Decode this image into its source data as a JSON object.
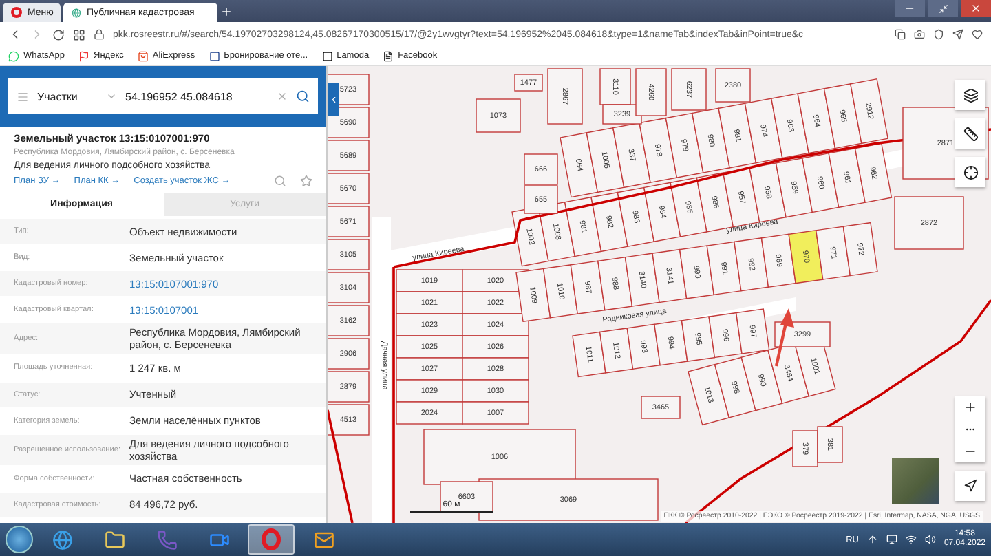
{
  "browser": {
    "tabs": [
      {
        "label": "Меню",
        "kind": "menu",
        "selected": false
      },
      {
        "label": "Публичная кадастровая",
        "kind": "page",
        "selected": true
      }
    ],
    "address": "pkk.rosreestr.ru/#/search/54.19702703298124,45.08267170300515/17/@2y1wvgtyr?text=54.196952%2045.084618&type=1&nameTab&indexTab&inPoint=true&c",
    "bookmarks": [
      {
        "label": "WhatsApp",
        "kind": "whatsapp"
      },
      {
        "label": "Яндекс",
        "kind": "yandex"
      },
      {
        "label": "AliExpress",
        "kind": "ali"
      },
      {
        "label": "Бронирование оте...",
        "kind": "booking"
      },
      {
        "label": "Lamoda",
        "kind": "lamoda"
      },
      {
        "label": "Facebook",
        "kind": "doc"
      }
    ]
  },
  "search": {
    "category": "Участки",
    "query": "54.196952 45.084618"
  },
  "card": {
    "title": "Земельный участок 13:15:0107001:970",
    "address": "Республика Мордовия, Лямбирский район, с. Берсеневка",
    "purpose": "Для ведения личного подсобного хозяйства",
    "links": [
      "План ЗУ →",
      "План КК →",
      "Создать участок ЖС →"
    ]
  },
  "tabs": [
    {
      "label": "Информация",
      "selected": true
    },
    {
      "label": "Услуги",
      "selected": false
    }
  ],
  "rows": [
    {
      "label": "Тип:",
      "value": "Объект недвижимости",
      "kind": "text"
    },
    {
      "label": "Вид:",
      "value": "Земельный участок",
      "kind": "text"
    },
    {
      "label": "Кадастровый номер:",
      "value": "13:15:0107001:970",
      "kind": "link"
    },
    {
      "label": "Кадастровый квартал:",
      "value": "13:15:0107001",
      "kind": "link"
    },
    {
      "label": "Адрес:",
      "value": "Республика Мордовия, Лямбирский район, с. Берсеневка",
      "kind": "text"
    },
    {
      "label": "Площадь уточненная:",
      "value": "1 247 кв. м",
      "kind": "text"
    },
    {
      "label": "Статус:",
      "value": "Учтенный",
      "kind": "text"
    },
    {
      "label": "Категория земель:",
      "value": "Земли населённых пунктов",
      "kind": "text"
    },
    {
      "label": "Разрешенное использование:",
      "value": "Для ведения личного подсобного хозяйства",
      "kind": "text"
    },
    {
      "label": "Форма собственности:",
      "value": "Частная собственность",
      "kind": "text"
    },
    {
      "label": "Кадастровая стоимость:",
      "value": "84 496,72 руб.",
      "kind": "text"
    }
  ],
  "map": {
    "rows": [
      {
        "parcels": [
          {
            "number": "664",
            "selected": false
          },
          {
            "number": "1005",
            "selected": false
          },
          {
            "number": "337",
            "selected": false
          },
          {
            "number": "978",
            "selected": false
          },
          {
            "number": "979",
            "selected": false
          },
          {
            "number": "980",
            "selected": false
          },
          {
            "number": "981",
            "selected": false
          },
          {
            "number": "974",
            "selected": false
          },
          {
            "number": "963",
            "selected": false
          },
          {
            "number": "964",
            "selected": false
          },
          {
            "number": "965",
            "selected": false
          },
          {
            "number": "2912",
            "selected": false
          }
        ]
      },
      {
        "parcels": [
          {
            "number": "1002",
            "selected": false
          },
          {
            "number": "1008",
            "selected": false
          },
          {
            "number": "981",
            "selected": false
          },
          {
            "number": "982",
            "selected": false
          },
          {
            "number": "983",
            "selected": false
          },
          {
            "number": "984",
            "selected": false
          },
          {
            "number": "985",
            "selected": false
          },
          {
            "number": "986",
            "selected": false
          },
          {
            "number": "957",
            "selected": false
          },
          {
            "number": "958",
            "selected": false
          },
          {
            "number": "959",
            "selected": false
          },
          {
            "number": "960",
            "selected": false
          },
          {
            "number": "961",
            "selected": false
          },
          {
            "number": "962",
            "selected": false
          }
        ]
      },
      {
        "parcels": [
          {
            "number": "1009",
            "selected": false
          },
          {
            "number": "1010",
            "selected": false
          },
          {
            "number": "987",
            "selected": false
          },
          {
            "number": "988",
            "selected": false
          },
          {
            "number": "3140",
            "selected": false
          },
          {
            "number": "3141",
            "selected": false
          },
          {
            "number": "990",
            "selected": false
          },
          {
            "number": "991",
            "selected": false
          },
          {
            "number": "992",
            "selected": false
          },
          {
            "number": "969",
            "selected": false
          },
          {
            "number": "970",
            "selected": true
          },
          {
            "number": "971",
            "selected": false
          },
          {
            "number": "972",
            "selected": false
          }
        ]
      },
      {
        "parcels": [
          {
            "number": "1011",
            "selected": false
          },
          {
            "number": "1012",
            "selected": false
          },
          {
            "number": "993",
            "selected": false
          },
          {
            "number": "994",
            "selected": false
          },
          {
            "number": "995",
            "selected": false
          },
          {
            "number": "996",
            "selected": false
          },
          {
            "number": "997",
            "selected": false
          }
        ]
      },
      {
        "parcels": [
          {
            "number": "1013",
            "selected": false
          },
          {
            "number": "998",
            "selected": false
          },
          {
            "number": "999",
            "selected": false
          },
          {
            "number": "3464",
            "selected": false
          },
          {
            "number": "1001",
            "selected": false
          }
        ]
      }
    ],
    "block": [
      "1019",
      "1020",
      "1021",
      "1022",
      "1023",
      "1024",
      "1025",
      "1026",
      "1027",
      "1028",
      "1029",
      "1030",
      "2024",
      "1007"
    ],
    "column": [
      "5723",
      "5690",
      "5689",
      "5670",
      "5671",
      "3105",
      "3104",
      "3162",
      "2906",
      "2879",
      "4513"
    ],
    "singles": [
      "2867",
      "3110",
      "3239",
      "4260",
      "6237",
      "2380",
      "2871",
      "2872",
      "666",
      "655",
      "1006",
      "3069",
      "6603",
      "3299",
      "3465",
      "1477",
      "1073",
      "379",
      "381"
    ],
    "streets": [
      "улица Киреева",
      "улица Киреева",
      "Дачная улица",
      "Родниковая улица"
    ],
    "scale": "60 м",
    "attribution": "ПКК © Росреестр 2010-2022 | ЕЭКО © Росреестр 2019-2022 | Esri, Intermap, NASA, NGA, USGS"
  },
  "taskbar": {
    "apps": [
      {
        "kind": "ie",
        "selected": false
      },
      {
        "kind": "folder",
        "selected": false
      },
      {
        "kind": "viber",
        "selected": false
      },
      {
        "kind": "zoom",
        "selected": false
      },
      {
        "kind": "opera",
        "selected": true
      },
      {
        "kind": "outlook",
        "selected": false
      }
    ],
    "language": "RU",
    "time": "14:58",
    "date": "07.04.2022"
  }
}
